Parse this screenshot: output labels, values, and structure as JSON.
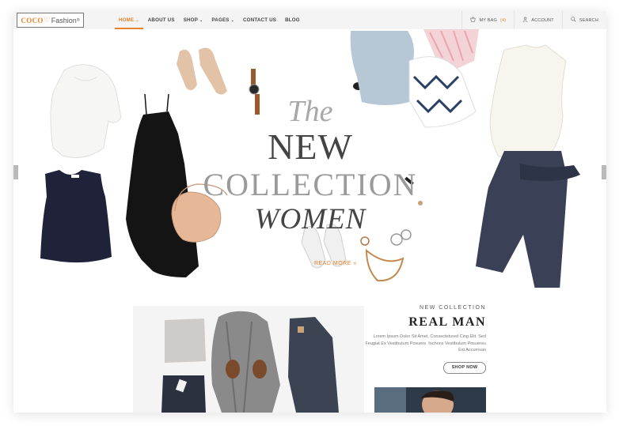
{
  "logo": {
    "part1": "COCO",
    "heart": "♡",
    "part2": "Fashion",
    "reg": "®"
  },
  "nav": [
    {
      "label": "HOME",
      "caret": "⌄"
    },
    {
      "label": "ABOUT US",
      "caret": ""
    },
    {
      "label": "SHOP",
      "caret": "⌄"
    },
    {
      "label": "PAGES",
      "caret": "⌄"
    },
    {
      "label": "CONTACT US",
      "caret": ""
    },
    {
      "label": "BLOG",
      "caret": ""
    }
  ],
  "tools": {
    "bag_label": "MY BAG",
    "bag_count": "(4)",
    "account_label": "ACCOUNT",
    "search_label": "SEARCH"
  },
  "hero": {
    "line1": "The",
    "line2": "NEW",
    "line3": "COLLECTION",
    "line4": "WOMEN",
    "cta": "READ MORE »"
  },
  "promo": {
    "subtitle": "NEW COLLECTION",
    "title": "REAL MAN",
    "body": "Lorem Ipsum Dolor Sit Amet, Consectetured Cing Elit. Sed Feugiat Ex Vestibulum Posuere. Inchons Vestibulum Posuereu Est Accumsan",
    "button": "SHOP NOW"
  },
  "colors": {
    "accent": "#e8822c",
    "header_bg": "#f4f4f4"
  },
  "icons": {
    "bag": "shopping-bag-icon",
    "account": "user-icon",
    "search": "search-icon"
  }
}
